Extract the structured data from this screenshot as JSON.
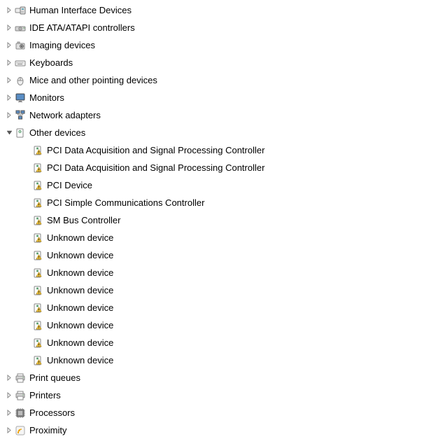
{
  "categories": [
    {
      "id": "hid",
      "label": "Human Interface Devices",
      "expanded": false,
      "icon": "hid"
    },
    {
      "id": "ide",
      "label": "IDE ATA/ATAPI controllers",
      "expanded": false,
      "icon": "ide"
    },
    {
      "id": "imaging",
      "label": "Imaging devices",
      "expanded": false,
      "icon": "imaging"
    },
    {
      "id": "keyboards",
      "label": "Keyboards",
      "expanded": false,
      "icon": "keyboard"
    },
    {
      "id": "mice",
      "label": "Mice and other pointing devices",
      "expanded": false,
      "icon": "mouse"
    },
    {
      "id": "monitors",
      "label": "Monitors",
      "expanded": false,
      "icon": "monitor"
    },
    {
      "id": "network",
      "label": "Network adapters",
      "expanded": false,
      "icon": "network"
    },
    {
      "id": "other",
      "label": "Other devices",
      "expanded": true,
      "icon": "other",
      "children": [
        {
          "label": "PCI Data Acquisition and Signal Processing Controller",
          "icon": "warning"
        },
        {
          "label": "PCI Data Acquisition and Signal Processing Controller",
          "icon": "warning"
        },
        {
          "label": "PCI Device",
          "icon": "warning"
        },
        {
          "label": "PCI Simple Communications Controller",
          "icon": "warning"
        },
        {
          "label": "SM Bus Controller",
          "icon": "warning"
        },
        {
          "label": "Unknown device",
          "icon": "warning"
        },
        {
          "label": "Unknown device",
          "icon": "warning"
        },
        {
          "label": "Unknown device",
          "icon": "warning"
        },
        {
          "label": "Unknown device",
          "icon": "warning"
        },
        {
          "label": "Unknown device",
          "icon": "warning"
        },
        {
          "label": "Unknown device",
          "icon": "warning"
        },
        {
          "label": "Unknown device",
          "icon": "warning"
        },
        {
          "label": "Unknown device",
          "icon": "warning"
        }
      ]
    },
    {
      "id": "printqueues",
      "label": "Print queues",
      "expanded": false,
      "icon": "printer"
    },
    {
      "id": "printers",
      "label": "Printers",
      "expanded": false,
      "icon": "printer"
    },
    {
      "id": "processors",
      "label": "Processors",
      "expanded": false,
      "icon": "processor"
    },
    {
      "id": "proximity",
      "label": "Proximity",
      "expanded": false,
      "icon": "proximity"
    }
  ]
}
